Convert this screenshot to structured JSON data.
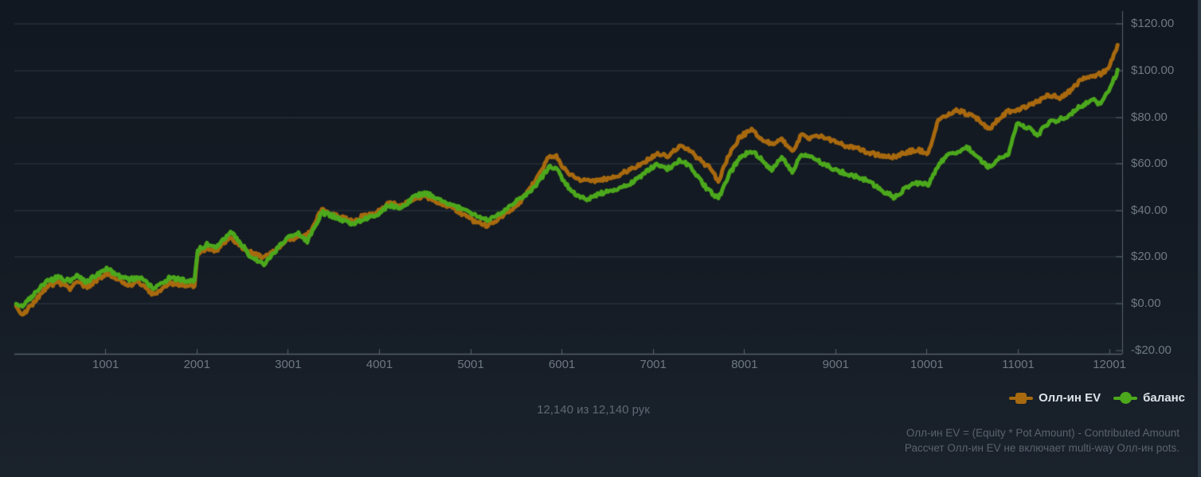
{
  "chart_data": {
    "type": "line",
    "title": "",
    "x_axis": {
      "range": [
        0,
        12140
      ],
      "ticks": [
        1001,
        2001,
        3001,
        4001,
        5001,
        6001,
        7001,
        8001,
        9001,
        10001,
        11001,
        12001
      ],
      "tick_labels": [
        "1001",
        "2001",
        "3001",
        "4001",
        "5001",
        "6001",
        "7001",
        "8001",
        "9001",
        "10001",
        "11001",
        "12001"
      ]
    },
    "y_axis": {
      "range": [
        -21.5,
        121.5
      ],
      "ticks": [
        120,
        100,
        80,
        60,
        40,
        20,
        0,
        -20
      ],
      "tick_labels": [
        "$120.00",
        "$100.00",
        "$80.00",
        "$60.00",
        "$40.00",
        "$20.00",
        "$0.00",
        "-$20.00"
      ],
      "gridline_values": [
        120,
        100,
        80,
        60,
        40,
        20,
        0
      ]
    },
    "grid": true,
    "legend_position": "bottom-right",
    "series": [
      {
        "name": "Олл-ин EV",
        "color": "#a8690f",
        "marker": "square",
        "points": [
          [
            20,
            -1.5
          ],
          [
            90,
            -5
          ],
          [
            350,
            6.8
          ],
          [
            480,
            9
          ],
          [
            610,
            6.5
          ],
          [
            700,
            9.9
          ],
          [
            785,
            6.8
          ],
          [
            915,
            10.6
          ],
          [
            1025,
            13
          ],
          [
            1130,
            11
          ],
          [
            1260,
            7.9
          ],
          [
            1365,
            9.5
          ],
          [
            1520,
            4.1
          ],
          [
            1695,
            8.5
          ],
          [
            1850,
            8.2
          ],
          [
            1975,
            7.5
          ],
          [
            2010,
            21.8
          ],
          [
            2110,
            23.9
          ],
          [
            2215,
            22.5
          ],
          [
            2370,
            29
          ],
          [
            2475,
            24.6
          ],
          [
            2605,
            21.8
          ],
          [
            2735,
            19.5
          ],
          [
            2865,
            22.9
          ],
          [
            2995,
            27
          ],
          [
            3100,
            28.9
          ],
          [
            3210,
            29
          ],
          [
            3370,
            40.3
          ],
          [
            3515,
            38.2
          ],
          [
            3690,
            35.5
          ],
          [
            3820,
            37.5
          ],
          [
            3950,
            38.9
          ],
          [
            4105,
            43.3
          ],
          [
            4250,
            42.3
          ],
          [
            4380,
            45.1
          ],
          [
            4510,
            46.1
          ],
          [
            4670,
            43.3
          ],
          [
            4815,
            41
          ],
          [
            4945,
            37.5
          ],
          [
            5075,
            34.8
          ],
          [
            5180,
            33.4
          ],
          [
            5290,
            36.2
          ],
          [
            5420,
            39.9
          ],
          [
            5550,
            44
          ],
          [
            5665,
            50.2
          ],
          [
            5870,
            63.8
          ],
          [
            5940,
            63.1
          ],
          [
            6045,
            57
          ],
          [
            6160,
            53.9
          ],
          [
            6260,
            52.6
          ],
          [
            6420,
            53.2
          ],
          [
            6590,
            54.6
          ],
          [
            6765,
            58
          ],
          [
            6910,
            61.1
          ],
          [
            7050,
            64.8
          ],
          [
            7155,
            62.8
          ],
          [
            7285,
            67.6
          ],
          [
            7395,
            66.2
          ],
          [
            7500,
            62.1
          ],
          [
            7610,
            58.7
          ],
          [
            7715,
            52.6
          ],
          [
            7830,
            63.8
          ],
          [
            7950,
            71.7
          ],
          [
            8080,
            74.4
          ],
          [
            8195,
            70.7
          ],
          [
            8300,
            68.3
          ],
          [
            8410,
            70.7
          ],
          [
            8525,
            65.5
          ],
          [
            8625,
            72.4
          ],
          [
            8715,
            71
          ],
          [
            8845,
            71.7
          ],
          [
            8975,
            70
          ],
          [
            9105,
            67.9
          ],
          [
            9235,
            67.2
          ],
          [
            9365,
            64.8
          ],
          [
            9495,
            63.5
          ],
          [
            9650,
            63.1
          ],
          [
            9755,
            64.8
          ],
          [
            9885,
            66.2
          ],
          [
            10015,
            64.5
          ],
          [
            10125,
            79.2
          ],
          [
            10230,
            81.6
          ],
          [
            10335,
            83.3
          ],
          [
            10450,
            81.2
          ],
          [
            10560,
            79.2
          ],
          [
            10680,
            74.7
          ],
          [
            10795,
            79.9
          ],
          [
            10895,
            82.6
          ],
          [
            10985,
            83.3
          ],
          [
            11095,
            85
          ],
          [
            11210,
            86.7
          ],
          [
            11330,
            89.4
          ],
          [
            11470,
            88.4
          ],
          [
            11590,
            92.1
          ],
          [
            11705,
            96.9
          ],
          [
            11815,
            98
          ],
          [
            11905,
            98.6
          ],
          [
            11980,
            100.3
          ],
          [
            12035,
            105.8
          ],
          [
            12090,
            110.6
          ]
        ]
      },
      {
        "name": "баланс",
        "color": "#4ca81c",
        "marker": "circle",
        "points": [
          [
            20,
            0.5
          ],
          [
            90,
            -1
          ],
          [
            350,
            9.2
          ],
          [
            480,
            11.4
          ],
          [
            610,
            9.6
          ],
          [
            700,
            12.3
          ],
          [
            785,
            9.2
          ],
          [
            915,
            12.6
          ],
          [
            1025,
            15
          ],
          [
            1130,
            12.3
          ],
          [
            1260,
            10.2
          ],
          [
            1365,
            11.6
          ],
          [
            1520,
            6.8
          ],
          [
            1695,
            10.9
          ],
          [
            1850,
            10.2
          ],
          [
            1975,
            9.6
          ],
          [
            2010,
            22.9
          ],
          [
            2110,
            25.3
          ],
          [
            2215,
            24.2
          ],
          [
            2370,
            30.7
          ],
          [
            2475,
            26.3
          ],
          [
            2605,
            19.5
          ],
          [
            2735,
            17.1
          ],
          [
            2865,
            22.9
          ],
          [
            2995,
            28.7
          ],
          [
            3100,
            30.4
          ],
          [
            3210,
            27
          ],
          [
            3370,
            39.2
          ],
          [
            3515,
            37.2
          ],
          [
            3690,
            34.1
          ],
          [
            3820,
            36.2
          ],
          [
            3950,
            37.5
          ],
          [
            4105,
            42.3
          ],
          [
            4250,
            41
          ],
          [
            4380,
            46.1
          ],
          [
            4510,
            47.4
          ],
          [
            4670,
            44.4
          ],
          [
            4815,
            42.3
          ],
          [
            4945,
            39.6
          ],
          [
            5075,
            37.5
          ],
          [
            5180,
            36.2
          ],
          [
            5290,
            38.2
          ],
          [
            5420,
            41.3
          ],
          [
            5550,
            45.4
          ],
          [
            5665,
            48.5
          ],
          [
            5870,
            59
          ],
          [
            5940,
            58
          ],
          [
            6045,
            51.2
          ],
          [
            6160,
            46.8
          ],
          [
            6260,
            44.7
          ],
          [
            6420,
            47.4
          ],
          [
            6590,
            49.1
          ],
          [
            6765,
            51.9
          ],
          [
            6910,
            56.3
          ],
          [
            7050,
            60.1
          ],
          [
            7155,
            57.7
          ],
          [
            7285,
            61.4
          ],
          [
            7395,
            59.4
          ],
          [
            7500,
            53.6
          ],
          [
            7610,
            48.5
          ],
          [
            7715,
            45.1
          ],
          [
            7830,
            55.3
          ],
          [
            7950,
            62.8
          ],
          [
            8080,
            65.5
          ],
          [
            8195,
            62.1
          ],
          [
            8300,
            57
          ],
          [
            8410,
            62.8
          ],
          [
            8525,
            56.3
          ],
          [
            8625,
            64.5
          ],
          [
            8715,
            63.1
          ],
          [
            8845,
            60.4
          ],
          [
            8975,
            58
          ],
          [
            9105,
            56
          ],
          [
            9235,
            54.6
          ],
          [
            9365,
            52.6
          ],
          [
            9495,
            49.1
          ],
          [
            9650,
            45.4
          ],
          [
            9755,
            49.5
          ],
          [
            9885,
            51.9
          ],
          [
            10015,
            51.2
          ],
          [
            10125,
            59.7
          ],
          [
            10230,
            63.5
          ],
          [
            10335,
            65.5
          ],
          [
            10450,
            66.9
          ],
          [
            10560,
            62.8
          ],
          [
            10680,
            58.7
          ],
          [
            10795,
            62.1
          ],
          [
            10895,
            63.8
          ],
          [
            10985,
            77.5
          ],
          [
            11095,
            75.8
          ],
          [
            11210,
            72.4
          ],
          [
            11330,
            77.5
          ],
          [
            11470,
            79.2
          ],
          [
            11590,
            81.9
          ],
          [
            11705,
            85.3
          ],
          [
            11815,
            87.4
          ],
          [
            11905,
            85.7
          ],
          [
            11980,
            90.4
          ],
          [
            12035,
            95.2
          ],
          [
            12090,
            99.7
          ]
        ]
      }
    ]
  },
  "footer": {
    "hands_text": "12,140 из 12,140 рук",
    "footnote_line1": "Олл-ин EV = (Equity * Pot Amount) - Contributed Amount",
    "footnote_line2": "Рассчет Олл-ин EV не включает multi-way Олл-ин pots."
  },
  "colors": {
    "background_top": "#121821",
    "background_bottom": "#1a222c",
    "gridline": "#2e3843",
    "axis": "#57626c",
    "axis_label": "#6e7882",
    "hands_text": "#5f6973",
    "footnote_text": "#59636e",
    "legend_text": "#dde3e9",
    "edge_strip": "#2d3944"
  }
}
